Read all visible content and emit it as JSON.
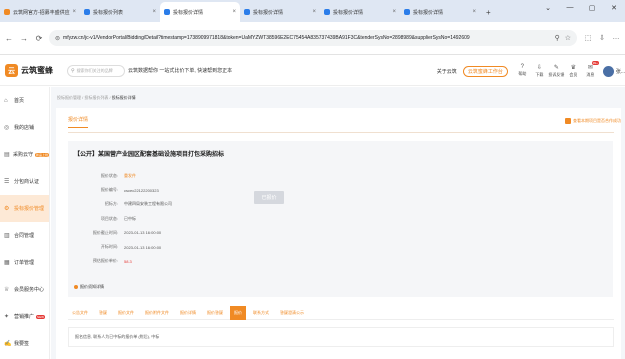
{
  "browser": {
    "tabs": [
      {
        "label": "云筑网官方-招募丰盛供应",
        "active": false,
        "fav": "orange"
      },
      {
        "label": "投标报价列表",
        "active": false,
        "fav": "blue"
      },
      {
        "label": "投标报价详情",
        "active": true,
        "fav": "blue"
      },
      {
        "label": "投标报价详情",
        "active": false,
        "fav": "blue"
      },
      {
        "label": "投标报价详情",
        "active": false,
        "fav": "blue"
      },
      {
        "label": "投标报价详情",
        "active": false,
        "fav": "blue"
      }
    ],
    "close_glyph": "×",
    "new_tab": "+",
    "window_controls": [
      "⌄",
      "—",
      "▢",
      "✕"
    ],
    "url": "mfyzw.cn/jc-v1/VendorPortal/Bidding/Detail?timestamp=1738909971818&token=UaMYZWT38596E2EC75454A835737439BA91F3C&tenderSysNo=2898989&supplierSysNo=1492609",
    "nav_icons": [
      "←",
      "→",
      "⟳"
    ],
    "omni_icons": [
      "⚲",
      "☆"
    ],
    "right_icons": [
      "⬚",
      "⇩",
      "…"
    ]
  },
  "header": {
    "logo_mark": "云",
    "brand": "云筑蜜蜂",
    "search_placeholder": "搜索你们关注的品牌",
    "promo": "云筑数据帮你 一站式比价下单, 快速帮到您正本",
    "about": "关于云筑",
    "workbench": "云筑蜜蜂工作台",
    "items": [
      {
        "label": "帮助",
        "icon": "?"
      },
      {
        "label": "下载",
        "icon": "⇩"
      },
      {
        "label": "投诉反馈",
        "icon": "✎"
      },
      {
        "label": "会员",
        "icon": "♛"
      },
      {
        "label": "消息",
        "icon": "✉"
      }
    ],
    "msg_badge": "99+",
    "user_name": "张..."
  },
  "sidebar": {
    "items": [
      {
        "label": "首页",
        "icon": "⌂",
        "tag": "",
        "active": false
      },
      {
        "label": "我的店铺",
        "icon": "◎",
        "tag": "",
        "active": false
      },
      {
        "label": "采购云守",
        "icon": "▤",
        "tag": "新品上线",
        "active": false
      },
      {
        "label": "分包商认证",
        "icon": "☰",
        "tag": "",
        "active": false
      },
      {
        "label": "投标报价管理",
        "icon": "⚙",
        "tag": "",
        "active": true
      },
      {
        "label": "合同管理",
        "icon": "▥",
        "tag": "",
        "active": false
      },
      {
        "label": "订单管理",
        "icon": "▦",
        "tag": "",
        "active": false
      },
      {
        "label": "会员服务中心",
        "icon": "♕",
        "tag": "",
        "active": false
      },
      {
        "label": "营销推广",
        "icon": "✦",
        "tag": "NEW",
        "active": false
      },
      {
        "label": "我要签",
        "icon": "✍",
        "tag": "",
        "active": false
      }
    ]
  },
  "main": {
    "breadcrumbs": [
      "投标报价管理",
      "投标报价列表",
      "投标报价详情"
    ],
    "crumb_sep": " / ",
    "detail_tab": "报价详情",
    "top_link": "查看本期项目是否合作成功",
    "project_title": "【公开】某国营产业园区配套基础设施项目打包采购招标",
    "status_button": "已报价",
    "fields": [
      {
        "label": "报价状态:",
        "value": "重发件",
        "style": "accent"
      },
      {
        "label": "报价编号:",
        "value": "cscec22122200323",
        "style": ""
      },
      {
        "label": "招标方:",
        "value": "中建四局安装工程有限公司",
        "style": ""
      },
      {
        "label": "项目状态:",
        "value": "已中标",
        "style": ""
      },
      {
        "label": "报价截止时间:",
        "value": "2023-01-13 16:00:00",
        "style": ""
      },
      {
        "label": "开标时间:",
        "value": "2023-01-13 16:00:00",
        "style": ""
      },
      {
        "label": "预估报价单价:",
        "value": "58.3",
        "style": "price"
      }
    ],
    "warning": "报价须知详情",
    "subtabs": [
      "公告文件",
      "答疑",
      "报价文件",
      "报价附件文件",
      "报价详情",
      "报价答疑",
      "报价",
      "联系方式",
      "答疑澄清公示"
    ],
    "active_subtab": 6,
    "bottom_text": "报名信息, 联系人为已中标的报价单 (附后), 中标"
  }
}
